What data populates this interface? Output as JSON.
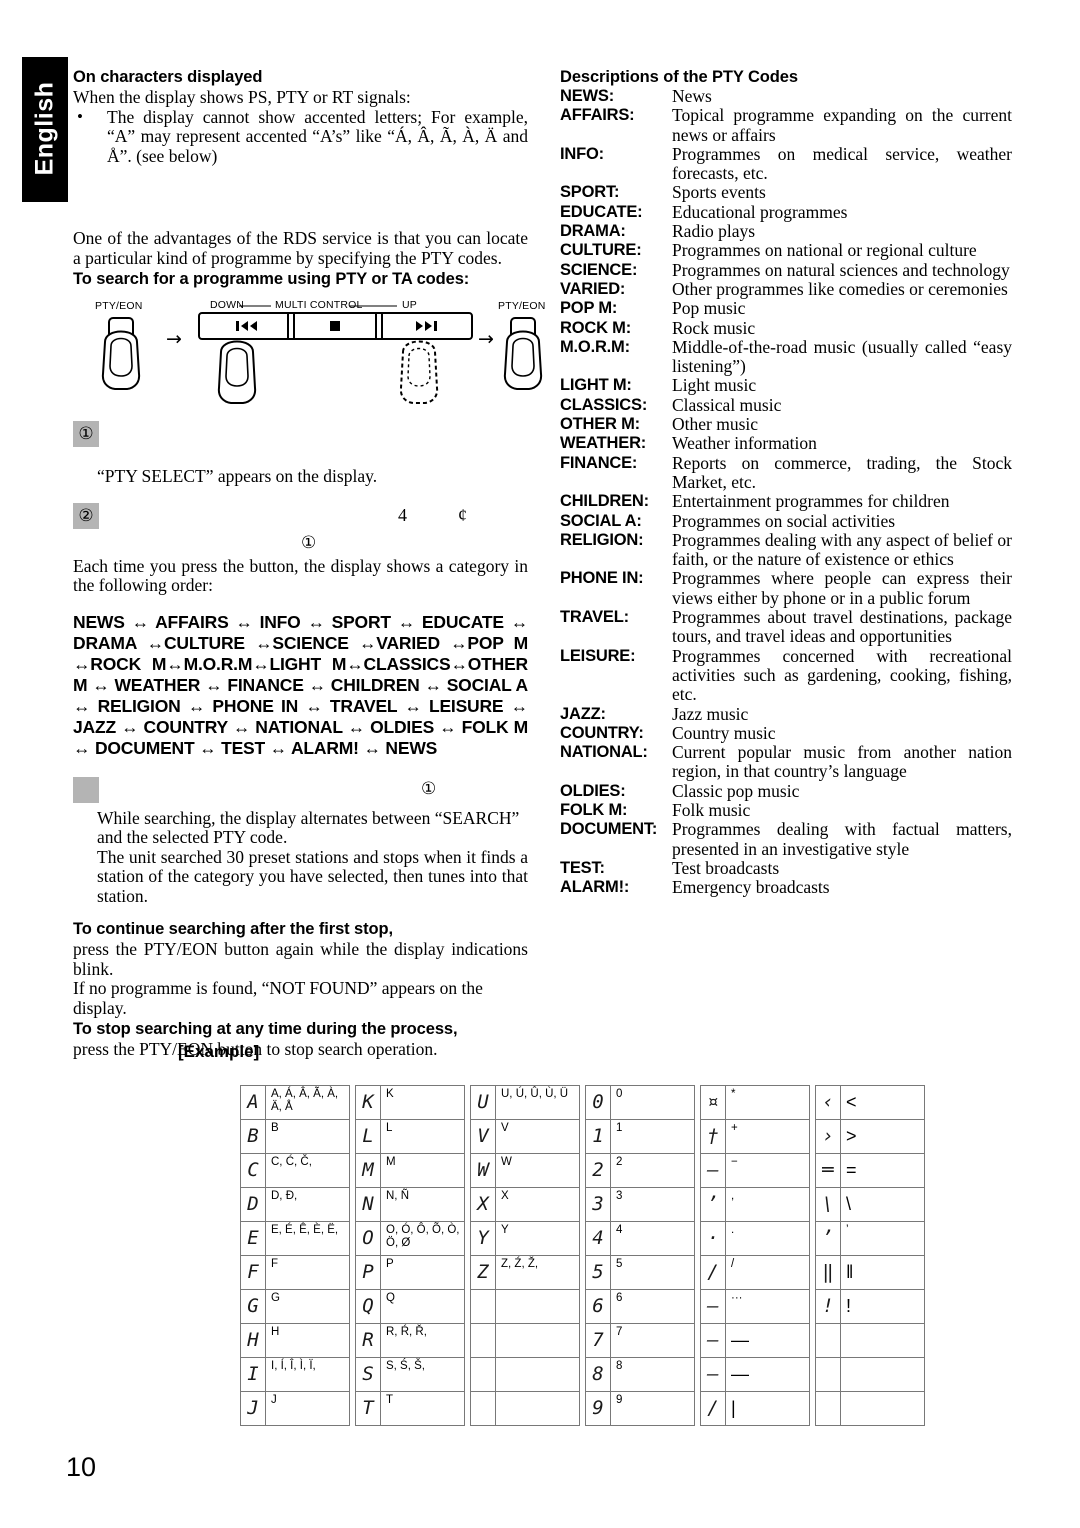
{
  "sidebar": {
    "language_tab": "English"
  },
  "page": {
    "number": "10"
  },
  "left": {
    "heading_chars": "On characters displayed",
    "intro_chars": "When the display shows PS, PTY or RT signals:",
    "bullets": [
      "The display cannot show accented letters; For example, “A” may represent accented “A’s” like “Á, Â, Ã, À, Ä and Å”. (see below)"
    ],
    "rds_paragraph": "One of the advantages of the RDS service is that you can locate a particular kind of programme by specifying the PTY codes.",
    "heading_search": "To search for a programme using PTY or TA codes:",
    "diagram": {
      "left_button_label": "PTY/EON",
      "right_button_label": "PTY/EON",
      "multi_down": "DOWN",
      "multi_center": "MULTI CONTROL",
      "multi_up": "UP",
      "arrow": "→",
      "btn_prev": "⏮",
      "btn_stop": "■",
      "btn_next": "⏭"
    },
    "step1_num": "①",
    "step1_note": "“PTY SELECT” appears on the display.",
    "step2_num": "②",
    "step2_sym_a": "4",
    "step2_sym_b": "¢",
    "circled_1": "①",
    "order_intro": "Each time you press the button, the display shows a category in the following order:",
    "category_chain": "NEWS ↔ AFFAIRS ↔ INFO ↔ SPORT ↔ EDUCATE ↔ DRAMA ↔CULTURE ↔SCIENCE ↔VARIED ↔POP M ↔ROCK M↔M.O.R.M↔LIGHT M↔CLASSICS↔OTHER M ↔ WEATHER ↔ FINANCE ↔ CHILDREN ↔ SOCIAL A ↔ RELIGION ↔ PHONE IN ↔ TRAVEL ↔ LEISURE ↔ JAZZ ↔ COUNTRY ↔ NATIONAL ↔ OLDIES ↔ FOLK M ↔ DOCUMENT ↔ TEST ↔ ALARM! ↔ NEWS",
    "circled_1b": "①",
    "search_note_1": "While searching, the display alternates between “SEARCH” and the selected PTY code.",
    "search_note_2": "The unit searched 30 preset stations and stops when it finds a station of the category you have selected, then tunes into that station.",
    "heading_continue": "To continue searching after the first stop,",
    "continue_body_1": "press the PTY/EON button again while the display indications blink.",
    "continue_body_2": "If no programme is found, “NOT FOUND” appears on the display.",
    "heading_stop": "To stop searching at any time during the process,",
    "stop_body": "press the PTY/EON button to stop search operation."
  },
  "right": {
    "heading": "Descriptions of the PTY Codes",
    "codes": [
      {
        "term": "NEWS:",
        "desc": "News"
      },
      {
        "term": "AFFAIRS:",
        "desc": "Topical programme expanding on the current news or affairs"
      },
      {
        "term": "INFO:",
        "desc": "Programmes on medical service, weather forecasts, etc."
      },
      {
        "term": "SPORT:",
        "desc": "Sports events"
      },
      {
        "term": "EDUCATE:",
        "desc": "Educational programmes"
      },
      {
        "term": "DRAMA:",
        "desc": "Radio plays"
      },
      {
        "term": "CULTURE:",
        "desc": "Programmes on national or regional culture"
      },
      {
        "term": "SCIENCE:",
        "desc": "Programmes on natural sciences and technology"
      },
      {
        "term": "VARIED:",
        "desc": "Other programmes like comedies or ceremonies"
      },
      {
        "term": "POP M:",
        "desc": "Pop music"
      },
      {
        "term": "ROCK M:",
        "desc": "Rock music"
      },
      {
        "term": "M.O.R.M:",
        "desc": "Middle-of-the-road music (usually called “easy listening”)"
      },
      {
        "term": "LIGHT M:",
        "desc": "Light music"
      },
      {
        "term": "CLASSICS:",
        "desc": "Classical music"
      },
      {
        "term": "OTHER M:",
        "desc": "Other music"
      },
      {
        "term": "WEATHER:",
        "desc": "Weather information"
      },
      {
        "term": "FINANCE:",
        "desc": "Reports on commerce, trading, the Stock Market, etc."
      },
      {
        "term": "CHILDREN:",
        "desc": "Entertainment programmes for children"
      },
      {
        "term": "SOCIAL A:",
        "desc": "Programmes on social activities"
      },
      {
        "term": "RELIGION:",
        "desc": "Programmes dealing with any aspect of belief or faith, or the nature of existence or ethics"
      },
      {
        "term": "PHONE IN:",
        "desc": "Programmes where people can express their views either by phone or in a public forum"
      },
      {
        "term": "TRAVEL:",
        "desc": "Programmes about travel destinations, package tours, and travel ideas and opportunities"
      },
      {
        "term": "LEISURE:",
        "desc": "Programmes concerned with recreational activities such as gardening, cooking, fishing, etc."
      },
      {
        "term": "JAZZ:",
        "desc": "Jazz music"
      },
      {
        "term": "COUNTRY:",
        "desc": "Country music"
      },
      {
        "term": "NATIONAL:",
        "desc": "Current popular music from another nation region, in that country’s language"
      },
      {
        "term": "OLDIES:",
        "desc": "Classic pop music"
      },
      {
        "term": "FOLK M:",
        "desc": "Folk music"
      },
      {
        "term": "DOCUMENT:",
        "desc": "Programmes dealing with factual matters, presented in an investigative style"
      },
      {
        "term": "TEST:",
        "desc": "Test broadcasts"
      },
      {
        "term": "ALARM!:",
        "desc": "Emergency broadcasts"
      }
    ]
  },
  "example": {
    "label": "[Example]",
    "rows": [
      [
        {
          "glyph": "A",
          "chars": "A, Á, Â, Ã, À, Ä, Å"
        },
        {
          "glyph": "K",
          "chars": "K"
        },
        {
          "glyph": "U",
          "chars": "U, Ú, Û, Ù, Ü"
        },
        {
          "glyph": "0",
          "chars": "0"
        },
        {
          "glyph": "¤",
          "chars": "*"
        },
        {
          "glyph": "‹",
          "chars": "<"
        }
      ],
      [
        {
          "glyph": "B",
          "chars": "B"
        },
        {
          "glyph": "L",
          "chars": "L"
        },
        {
          "glyph": "V",
          "chars": "V"
        },
        {
          "glyph": "1",
          "chars": "1"
        },
        {
          "glyph": "†",
          "chars": "+"
        },
        {
          "glyph": "›",
          "chars": ">"
        }
      ],
      [
        {
          "glyph": "C",
          "chars": "C, Ć, Č,"
        },
        {
          "glyph": "M",
          "chars": "M"
        },
        {
          "glyph": "W",
          "chars": "W"
        },
        {
          "glyph": "2",
          "chars": "2"
        },
        {
          "glyph": "–",
          "chars": "−"
        },
        {
          "glyph": "═",
          "chars": "="
        }
      ],
      [
        {
          "glyph": "D",
          "chars": "D, Đ,"
        },
        {
          "glyph": "N",
          "chars": "N, Ñ"
        },
        {
          "glyph": "X",
          "chars": "X"
        },
        {
          "glyph": "3",
          "chars": "3"
        },
        {
          "glyph": "ʼ",
          "chars": ","
        },
        {
          "glyph": "\\",
          "chars": "\\"
        }
      ],
      [
        {
          "glyph": "E",
          "chars": "E, É, Ê, È, Ë,"
        },
        {
          "glyph": "O",
          "chars": "O, Ó, Ô, Õ, Ò, Ö, Ø"
        },
        {
          "glyph": "Y",
          "chars": "Y"
        },
        {
          "glyph": "4",
          "chars": "4"
        },
        {
          "glyph": "·",
          "chars": "."
        },
        {
          "glyph": "ʼ",
          "chars": "’"
        }
      ],
      [
        {
          "glyph": "F",
          "chars": "F"
        },
        {
          "glyph": "P",
          "chars": "P"
        },
        {
          "glyph": "Z",
          "chars": "Z, Ź, Ž,"
        },
        {
          "glyph": "5",
          "chars": "5"
        },
        {
          "glyph": "/",
          "chars": "/"
        },
        {
          "glyph": "‖",
          "chars": "‖"
        }
      ],
      [
        {
          "glyph": "G",
          "chars": "G"
        },
        {
          "glyph": "Q",
          "chars": "Q"
        },
        {
          "glyph": "",
          "chars": ""
        },
        {
          "glyph": "6",
          "chars": "6"
        },
        {
          "glyph": "–",
          "chars": "···"
        },
        {
          "glyph": "!",
          "chars": "!"
        }
      ],
      [
        {
          "glyph": "H",
          "chars": "H"
        },
        {
          "glyph": "R",
          "chars": "R, Ŕ, Ř,"
        },
        {
          "glyph": "",
          "chars": ""
        },
        {
          "glyph": "7",
          "chars": "7"
        },
        {
          "glyph": "–",
          "chars": "—"
        },
        {
          "glyph": "",
          "chars": ""
        }
      ],
      [
        {
          "glyph": "I",
          "chars": "I, Í, Î, Ì, Ï,"
        },
        {
          "glyph": "S",
          "chars": "S, Ś, Š,"
        },
        {
          "glyph": "",
          "chars": ""
        },
        {
          "glyph": "8",
          "chars": "8"
        },
        {
          "glyph": "–",
          "chars": "—"
        },
        {
          "glyph": "",
          "chars": ""
        }
      ],
      [
        {
          "glyph": "J",
          "chars": "J"
        },
        {
          "glyph": "T",
          "chars": "T"
        },
        {
          "glyph": "",
          "chars": ""
        },
        {
          "glyph": "9",
          "chars": "9"
        },
        {
          "glyph": "/",
          "chars": "|"
        },
        {
          "glyph": "",
          "chars": ""
        }
      ]
    ]
  }
}
